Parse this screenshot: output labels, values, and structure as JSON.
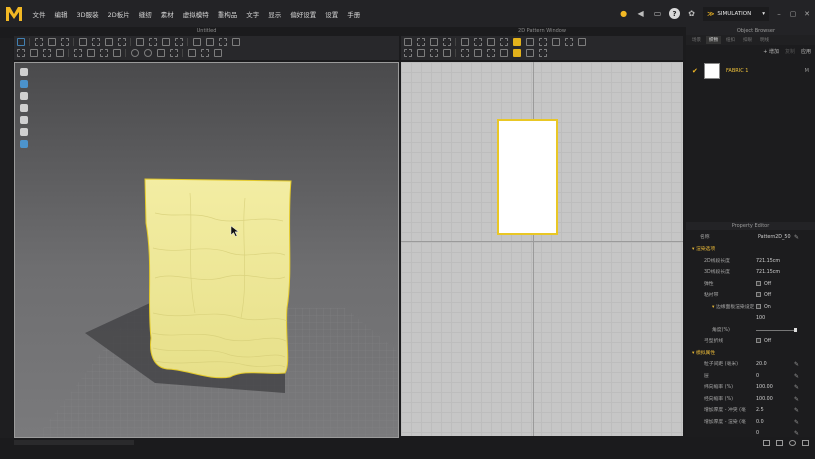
{
  "menu": [
    "文件",
    "编辑",
    "3D服装",
    "2D板片",
    "缝纫",
    "素材",
    "虚拟模特",
    "重构品",
    "文字",
    "显示",
    "偏好设置",
    "设置",
    "手册"
  ],
  "top_right": {
    "mode_label": "SIMULATION"
  },
  "panels": {
    "view3d_title": "Untitled",
    "view2d_title": "2D Pattern Window"
  },
  "object_browser": {
    "title": "Object Browser",
    "tabs": [
      "场景",
      "织物",
      "纽扣",
      "扣眼",
      "明线"
    ],
    "actions": [
      "+ 增加",
      "复制",
      "应用"
    ],
    "fabric": {
      "name": "FABRIC 1",
      "flag": "M"
    }
  },
  "property_editor": {
    "title": "Property Editor",
    "name_label": "名称",
    "name_value": "Pattern2D_50",
    "rows": [
      {
        "key": "渲染选项",
        "value": "",
        "type": "section"
      },
      {
        "key": "2D线段长度",
        "value": "721.15cm",
        "type": "value"
      },
      {
        "key": "3D线段长度",
        "value": "721.15cm",
        "type": "value"
      },
      {
        "key": "弹性",
        "value": "Off",
        "type": "check"
      },
      {
        "key": "粘衬带",
        "value": "Off",
        "type": "check"
      },
      {
        "key": "边缘面板渲染设定",
        "value": "On",
        "type": "subcheck"
      },
      {
        "key": "",
        "value": "100",
        "type": "plain"
      },
      {
        "key": "角度(%)",
        "value": "",
        "type": "slider"
      },
      {
        "key": "弓型折线",
        "value": "Off",
        "type": "check"
      },
      {
        "key": "模拟属性",
        "value": "",
        "type": "section"
      },
      {
        "key": "粒子间距 (毫米)",
        "value": "20.0",
        "type": "edit"
      },
      {
        "key": "层",
        "value": "0",
        "type": "edit"
      },
      {
        "key": "纬向缩率 (%)",
        "value": "100.00",
        "type": "edit"
      },
      {
        "key": "经向缩率 (%)",
        "value": "100.00",
        "type": "edit"
      },
      {
        "key": "增加厚度 - 冲突 (毫",
        "value": "2.5",
        "type": "edit"
      },
      {
        "key": "增加厚度 - 渲染 (毫",
        "value": "0.0",
        "type": "edit"
      },
      {
        "key": "",
        "value": "0",
        "type": "edit"
      }
    ]
  },
  "colors": {
    "accent": "#f2b824",
    "fabric": "#f3ec9c",
    "pattern_outline": "#e9c725"
  }
}
